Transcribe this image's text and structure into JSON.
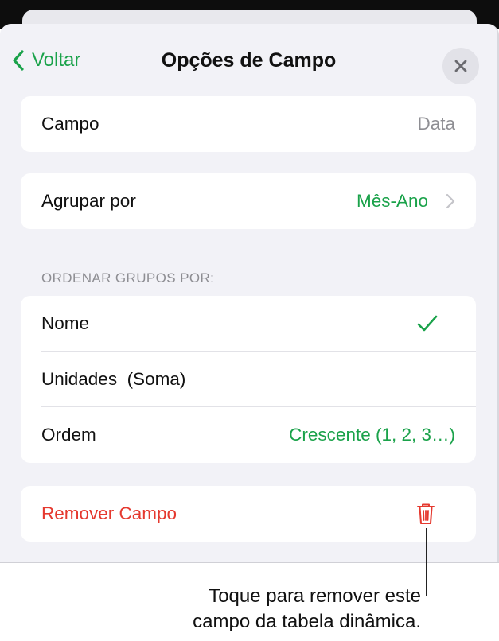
{
  "nav": {
    "back_label": "Voltar",
    "title": "Opções de Campo"
  },
  "field_card": {
    "label": "Campo",
    "value": "Data"
  },
  "group_card": {
    "label": "Agrupar por",
    "value": "Mês-Ano"
  },
  "sort_section": {
    "header": "ORDENAR GRUPOS POR:",
    "rows": [
      {
        "label": "Nome",
        "selected": true
      },
      {
        "label": "Unidades  (Soma)",
        "selected": false
      },
      {
        "label": "Ordem",
        "value": "Crescente (1, 2, 3…)"
      }
    ]
  },
  "remove_card": {
    "label": "Remover Campo"
  },
  "callout": {
    "line1": "Toque para remover este",
    "line2": "campo da tabela dinâmica."
  },
  "colors": {
    "accent_green": "#1aa24a",
    "destructive_red": "#e5392f",
    "secondary_text": "#8e8e93",
    "sheet_background": "#f2f2f7"
  },
  "icons": {
    "back": "chevron-left-icon",
    "close": "close-icon",
    "disclosure": "chevron-right-icon",
    "selected": "checkmark-icon",
    "remove": "trash-icon"
  }
}
